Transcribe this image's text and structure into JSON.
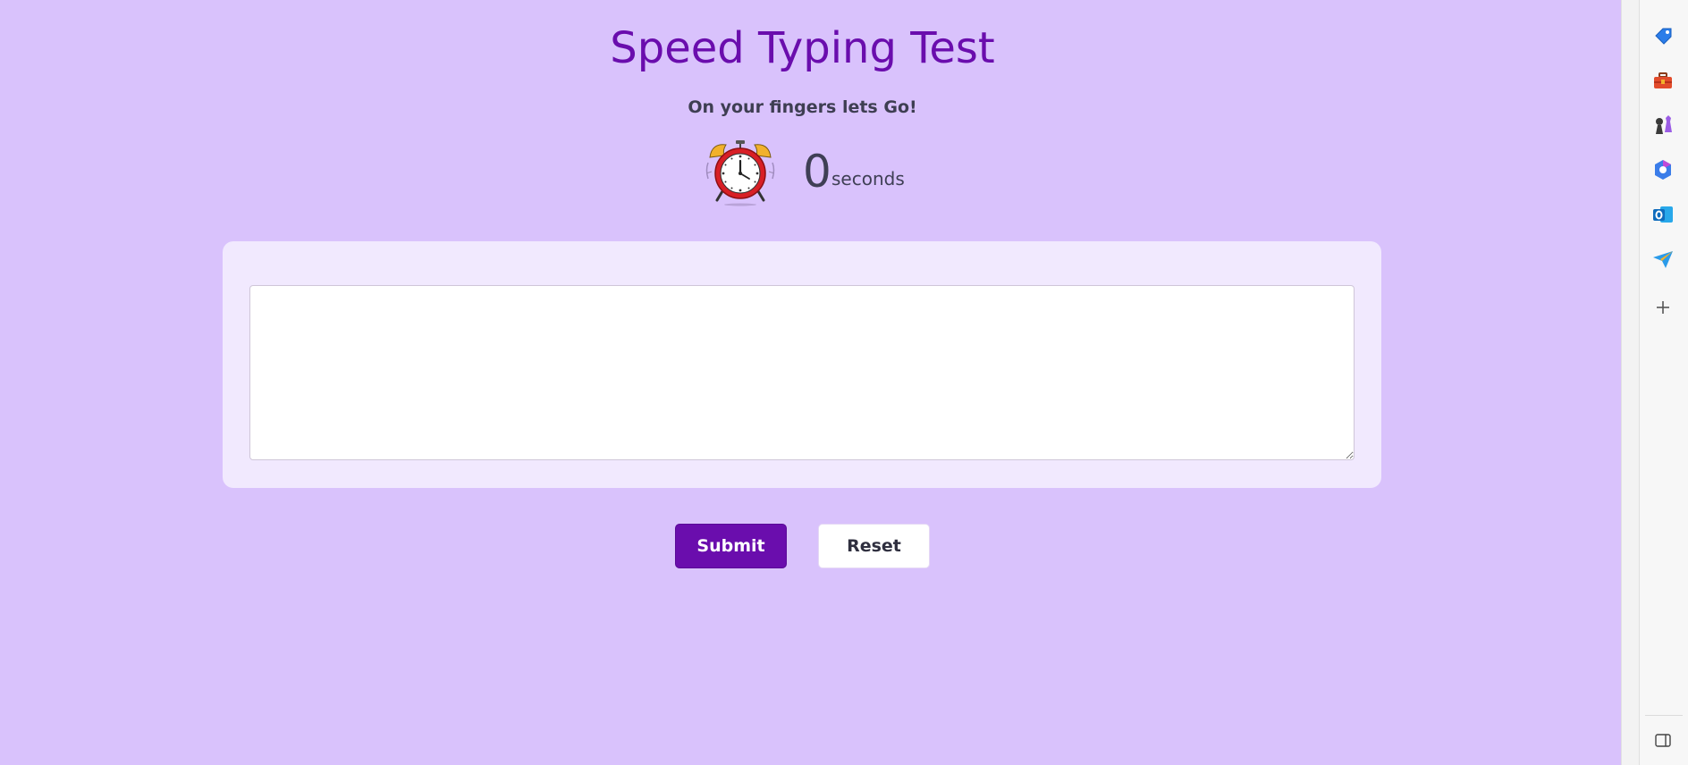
{
  "header": {
    "title": "Speed Typing Test",
    "subtitle": "On your fingers lets Go!"
  },
  "timer": {
    "value": "0",
    "unit": "seconds",
    "icon": "alarm-clock-icon"
  },
  "typing_area": {
    "value": "",
    "placeholder": ""
  },
  "buttons": {
    "submit_label": "Submit",
    "reset_label": "Reset"
  },
  "sidebar": {
    "icons": [
      "tag-icon",
      "toolbox-icon",
      "chess-pieces-icon",
      "copilot-icon",
      "outlook-icon",
      "send-icon",
      "add-icon",
      "panel-toggle-icon"
    ]
  },
  "colors": {
    "background": "#d9c2fc",
    "accent": "#6a0dad",
    "panel": "#f1e9fe"
  }
}
